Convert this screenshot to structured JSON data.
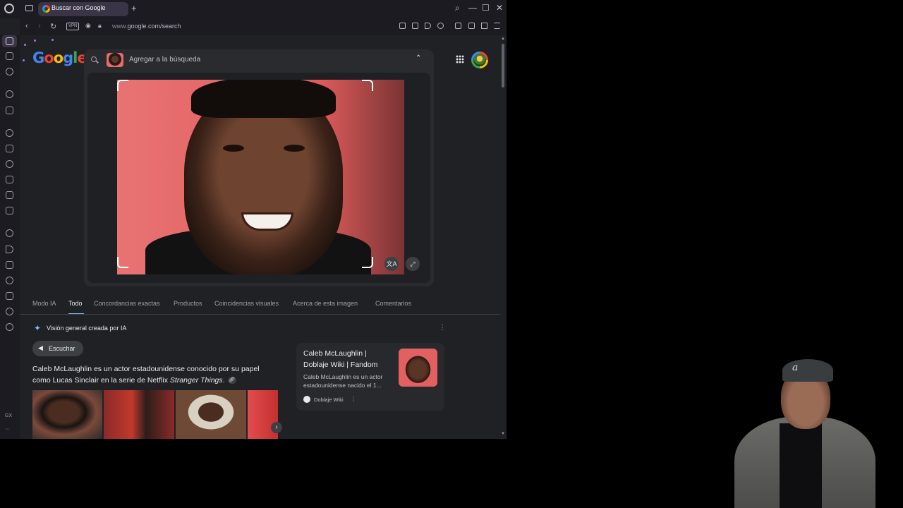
{
  "browser": {
    "tab_title": "Buscar con Google",
    "new_tab": "+",
    "window_controls": [
      "search",
      "minimize",
      "maximize",
      "close"
    ]
  },
  "address_bar": {
    "vpn": "VPN",
    "url_prefix": "www.",
    "url_domain": "google.com/search"
  },
  "sidebar": {
    "bottom_label": "GX",
    "more": "···"
  },
  "google": {
    "logo_letters": [
      "G",
      "o",
      "o",
      "g",
      "l",
      "e"
    ],
    "search_placeholder": "Agregar a la búsqueda",
    "collapse": "⌃"
  },
  "lens": {
    "translate_btn": "文A",
    "expand_btn": "⤢"
  },
  "filter_tabs": [
    "Modo IA",
    "Todo",
    "Concordancias exactas",
    "Productos",
    "Coincidencias visuales",
    "Acerca de esta imagen",
    "Comentarios"
  ],
  "active_tab": "Todo",
  "ai_overview": {
    "title": "Visión general creada por IA",
    "listen": "Escuchar",
    "text_main": "Caleb McLaughlin es un actor estadounidense conocido por su papel como Lucas Sinclair en la serie de Netflix ",
    "text_italic": "Stranger Things",
    "text_end": "."
  },
  "source_card": {
    "title": "Caleb McLaughlin | Doblaje Wiki | Fandom",
    "snippet": "Caleb McLaughlin es un actor estadounidense nacido el 1...",
    "site": "Doblaje Wiki",
    "more": "⋮"
  },
  "colors": {
    "page_bg": "#202124",
    "chrome_bg": "#1c1b22",
    "accent": "#8ab4f8",
    "photo_bg": "#e25c5c"
  }
}
